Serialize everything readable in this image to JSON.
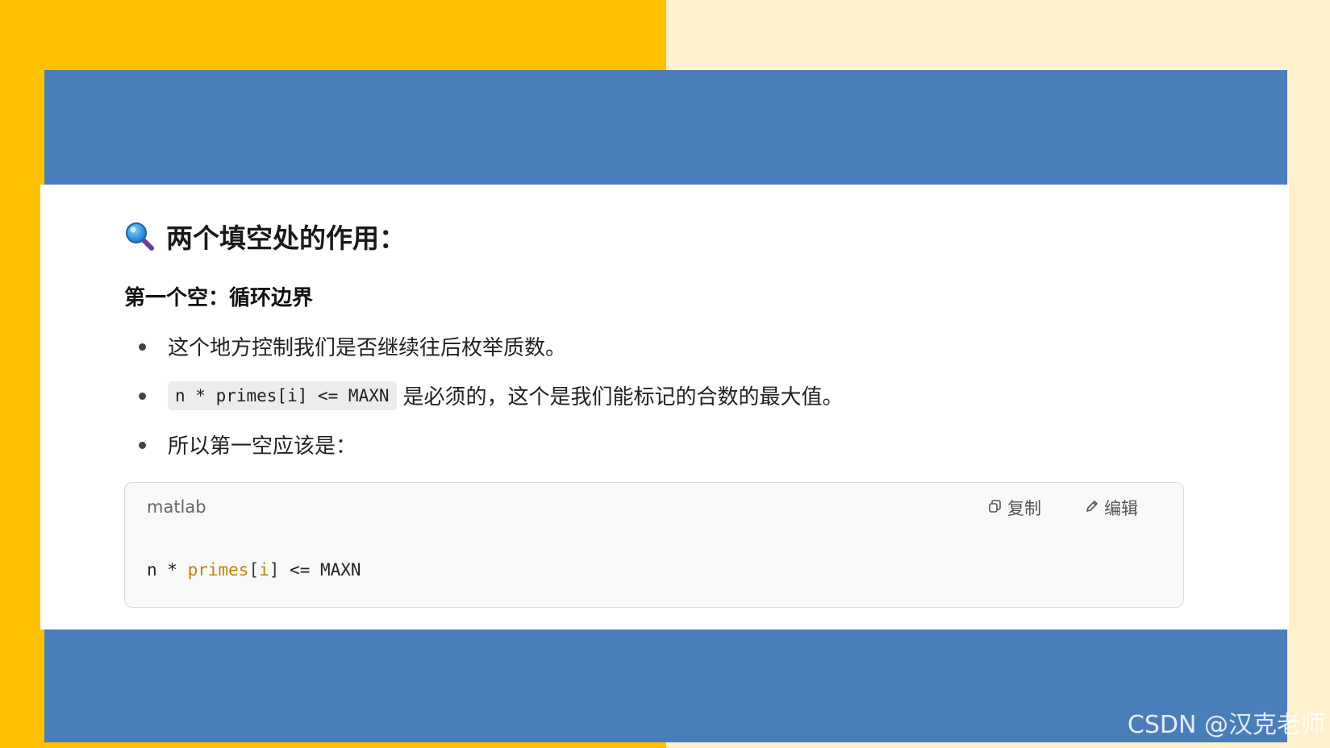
{
  "colors": {
    "background_cream": "#fff1cc",
    "background_yellow": "#ffc000",
    "band_blue": "#4a7ebb",
    "panel_white": "#ffffff",
    "code_fn": "#c18401"
  },
  "heading": {
    "icon": "magnifier-icon",
    "title": "两个填空处的作用："
  },
  "section": {
    "subtitle": "第一个空：循环边界"
  },
  "bullets": {
    "item1": "这个地方控制我们是否继续往后枚举质数。",
    "item2_code": "n * primes[i] <= MAXN",
    "item2_text": "是必须的，这个是我们能标记的合数的最大值。",
    "item3": "所以第一空应该是："
  },
  "codeblock": {
    "language": "matlab",
    "copy_label": "复制",
    "edit_label": "编辑",
    "code_prefix": "n * ",
    "code_fn": "primes",
    "code_open": "[",
    "code_idx": "i",
    "code_close": "]",
    "code_suffix": " <= MAXN"
  },
  "watermark": "CSDN @汉克老师"
}
